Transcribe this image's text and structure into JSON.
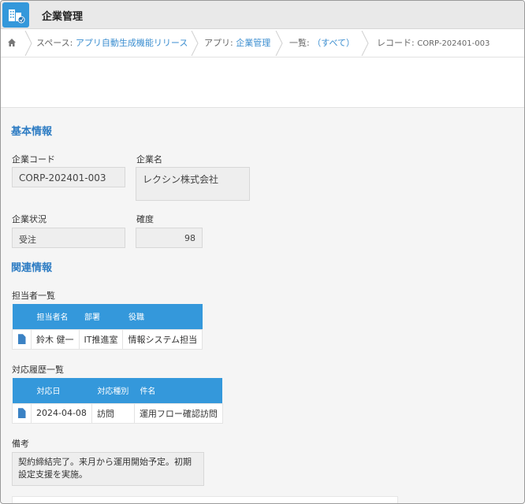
{
  "app": {
    "title": "企業管理",
    "icon": "building-app-icon",
    "accent": "#3498db"
  },
  "breadcrumb": {
    "home_icon": "home-icon",
    "space_prefix": "スペース:",
    "space_name": "アプリ自動生成機能リリース",
    "app_prefix": "アプリ:",
    "app_name": "企業管理",
    "list_prefix": "一覧:",
    "list_name": "（すべて）",
    "record_prefix": "レコード:",
    "record_id": "CORP-202401-003"
  },
  "basic": {
    "section_title": "基本情報",
    "code_label": "企業コード",
    "code_value": "CORP-202401-003",
    "name_label": "企業名",
    "name_value": "レクシン株式会社",
    "status_label": "企業状況",
    "status_value": "受注",
    "certainty_label": "確度",
    "certainty_value": "98"
  },
  "related": {
    "section_title": "関連情報",
    "contacts": {
      "label": "担当者一覧",
      "headers": [
        "担当者名",
        "部署",
        "役職"
      ],
      "rows": [
        [
          "鈴木 健一",
          "IT推進室",
          "情報システム担当"
        ]
      ]
    },
    "history": {
      "label": "対応履歴一覧",
      "headers": [
        "対応日",
        "対応種別",
        "件名"
      ],
      "rows": [
        [
          "2024-04-08",
          "訪問",
          "運用フロー確認訪問"
        ]
      ]
    }
  },
  "memo": {
    "label": "備考",
    "value": "契約締結完了。来月から運用開始予定。初期設定支援を実施。"
  }
}
